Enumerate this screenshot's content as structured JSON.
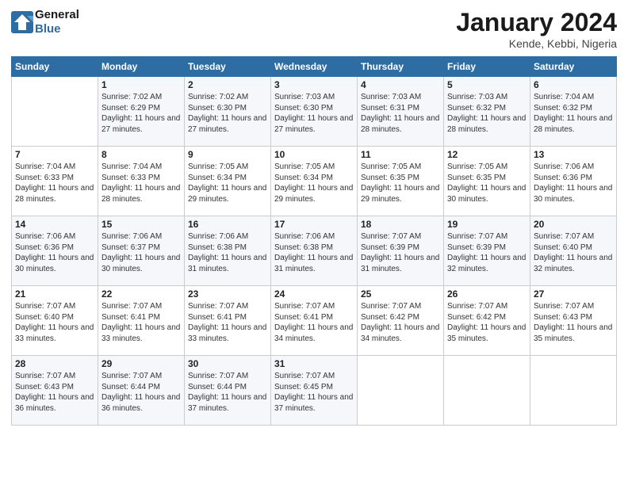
{
  "header": {
    "logo_line1": "General",
    "logo_line2": "Blue",
    "month": "January 2024",
    "location": "Kende, Kebbi, Nigeria"
  },
  "days_of_week": [
    "Sunday",
    "Monday",
    "Tuesday",
    "Wednesday",
    "Thursday",
    "Friday",
    "Saturday"
  ],
  "weeks": [
    [
      {
        "day": "",
        "sunrise": "",
        "sunset": "",
        "daylight": ""
      },
      {
        "day": "1",
        "sunrise": "Sunrise: 7:02 AM",
        "sunset": "Sunset: 6:29 PM",
        "daylight": "Daylight: 11 hours and 27 minutes."
      },
      {
        "day": "2",
        "sunrise": "Sunrise: 7:02 AM",
        "sunset": "Sunset: 6:30 PM",
        "daylight": "Daylight: 11 hours and 27 minutes."
      },
      {
        "day": "3",
        "sunrise": "Sunrise: 7:03 AM",
        "sunset": "Sunset: 6:30 PM",
        "daylight": "Daylight: 11 hours and 27 minutes."
      },
      {
        "day": "4",
        "sunrise": "Sunrise: 7:03 AM",
        "sunset": "Sunset: 6:31 PM",
        "daylight": "Daylight: 11 hours and 28 minutes."
      },
      {
        "day": "5",
        "sunrise": "Sunrise: 7:03 AM",
        "sunset": "Sunset: 6:32 PM",
        "daylight": "Daylight: 11 hours and 28 minutes."
      },
      {
        "day": "6",
        "sunrise": "Sunrise: 7:04 AM",
        "sunset": "Sunset: 6:32 PM",
        "daylight": "Daylight: 11 hours and 28 minutes."
      }
    ],
    [
      {
        "day": "7",
        "sunrise": "Sunrise: 7:04 AM",
        "sunset": "Sunset: 6:33 PM",
        "daylight": "Daylight: 11 hours and 28 minutes."
      },
      {
        "day": "8",
        "sunrise": "Sunrise: 7:04 AM",
        "sunset": "Sunset: 6:33 PM",
        "daylight": "Daylight: 11 hours and 28 minutes."
      },
      {
        "day": "9",
        "sunrise": "Sunrise: 7:05 AM",
        "sunset": "Sunset: 6:34 PM",
        "daylight": "Daylight: 11 hours and 29 minutes."
      },
      {
        "day": "10",
        "sunrise": "Sunrise: 7:05 AM",
        "sunset": "Sunset: 6:34 PM",
        "daylight": "Daylight: 11 hours and 29 minutes."
      },
      {
        "day": "11",
        "sunrise": "Sunrise: 7:05 AM",
        "sunset": "Sunset: 6:35 PM",
        "daylight": "Daylight: 11 hours and 29 minutes."
      },
      {
        "day": "12",
        "sunrise": "Sunrise: 7:05 AM",
        "sunset": "Sunset: 6:35 PM",
        "daylight": "Daylight: 11 hours and 30 minutes."
      },
      {
        "day": "13",
        "sunrise": "Sunrise: 7:06 AM",
        "sunset": "Sunset: 6:36 PM",
        "daylight": "Daylight: 11 hours and 30 minutes."
      }
    ],
    [
      {
        "day": "14",
        "sunrise": "Sunrise: 7:06 AM",
        "sunset": "Sunset: 6:36 PM",
        "daylight": "Daylight: 11 hours and 30 minutes."
      },
      {
        "day": "15",
        "sunrise": "Sunrise: 7:06 AM",
        "sunset": "Sunset: 6:37 PM",
        "daylight": "Daylight: 11 hours and 30 minutes."
      },
      {
        "day": "16",
        "sunrise": "Sunrise: 7:06 AM",
        "sunset": "Sunset: 6:38 PM",
        "daylight": "Daylight: 11 hours and 31 minutes."
      },
      {
        "day": "17",
        "sunrise": "Sunrise: 7:06 AM",
        "sunset": "Sunset: 6:38 PM",
        "daylight": "Daylight: 11 hours and 31 minutes."
      },
      {
        "day": "18",
        "sunrise": "Sunrise: 7:07 AM",
        "sunset": "Sunset: 6:39 PM",
        "daylight": "Daylight: 11 hours and 31 minutes."
      },
      {
        "day": "19",
        "sunrise": "Sunrise: 7:07 AM",
        "sunset": "Sunset: 6:39 PM",
        "daylight": "Daylight: 11 hours and 32 minutes."
      },
      {
        "day": "20",
        "sunrise": "Sunrise: 7:07 AM",
        "sunset": "Sunset: 6:40 PM",
        "daylight": "Daylight: 11 hours and 32 minutes."
      }
    ],
    [
      {
        "day": "21",
        "sunrise": "Sunrise: 7:07 AM",
        "sunset": "Sunset: 6:40 PM",
        "daylight": "Daylight: 11 hours and 33 minutes."
      },
      {
        "day": "22",
        "sunrise": "Sunrise: 7:07 AM",
        "sunset": "Sunset: 6:41 PM",
        "daylight": "Daylight: 11 hours and 33 minutes."
      },
      {
        "day": "23",
        "sunrise": "Sunrise: 7:07 AM",
        "sunset": "Sunset: 6:41 PM",
        "daylight": "Daylight: 11 hours and 33 minutes."
      },
      {
        "day": "24",
        "sunrise": "Sunrise: 7:07 AM",
        "sunset": "Sunset: 6:41 PM",
        "daylight": "Daylight: 11 hours and 34 minutes."
      },
      {
        "day": "25",
        "sunrise": "Sunrise: 7:07 AM",
        "sunset": "Sunset: 6:42 PM",
        "daylight": "Daylight: 11 hours and 34 minutes."
      },
      {
        "day": "26",
        "sunrise": "Sunrise: 7:07 AM",
        "sunset": "Sunset: 6:42 PM",
        "daylight": "Daylight: 11 hours and 35 minutes."
      },
      {
        "day": "27",
        "sunrise": "Sunrise: 7:07 AM",
        "sunset": "Sunset: 6:43 PM",
        "daylight": "Daylight: 11 hours and 35 minutes."
      }
    ],
    [
      {
        "day": "28",
        "sunrise": "Sunrise: 7:07 AM",
        "sunset": "Sunset: 6:43 PM",
        "daylight": "Daylight: 11 hours and 36 minutes."
      },
      {
        "day": "29",
        "sunrise": "Sunrise: 7:07 AM",
        "sunset": "Sunset: 6:44 PM",
        "daylight": "Daylight: 11 hours and 36 minutes."
      },
      {
        "day": "30",
        "sunrise": "Sunrise: 7:07 AM",
        "sunset": "Sunset: 6:44 PM",
        "daylight": "Daylight: 11 hours and 37 minutes."
      },
      {
        "day": "31",
        "sunrise": "Sunrise: 7:07 AM",
        "sunset": "Sunset: 6:45 PM",
        "daylight": "Daylight: 11 hours and 37 minutes."
      },
      {
        "day": "",
        "sunrise": "",
        "sunset": "",
        "daylight": ""
      },
      {
        "day": "",
        "sunrise": "",
        "sunset": "",
        "daylight": ""
      },
      {
        "day": "",
        "sunrise": "",
        "sunset": "",
        "daylight": ""
      }
    ]
  ]
}
